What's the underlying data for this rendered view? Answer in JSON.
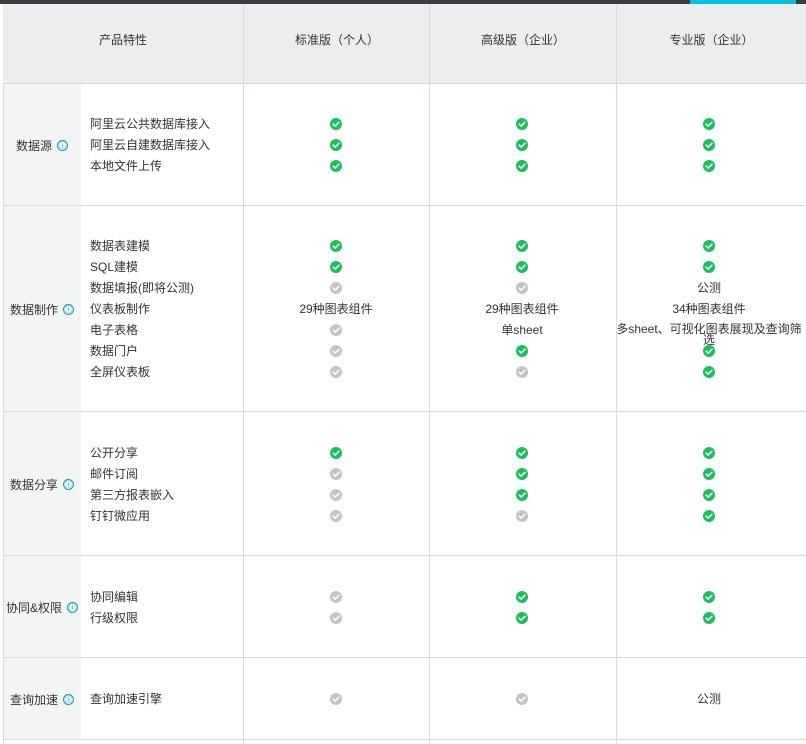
{
  "header": {
    "feature_col": "产品特性",
    "editions": [
      "标准版（个人）",
      "高级版（企业）",
      "专业版（企业）"
    ]
  },
  "info_icon": "ⓘ",
  "colors": {
    "enabled": "#19c15d",
    "disabled": "#c4c4c4",
    "info": "#00a2ca"
  },
  "icons": {
    "enabled": "check-circle-green-icon",
    "disabled": "check-circle-grey-icon"
  },
  "sections": [
    {
      "name": "数据源",
      "features": [
        "阿里云公共数据库接入",
        "阿里云自建数据库接入",
        "本地文件上传"
      ],
      "standard": [
        "yes",
        "yes",
        "yes"
      ],
      "advanced": [
        "yes",
        "yes",
        "yes"
      ],
      "professional": [
        "yes",
        "yes",
        "yes"
      ]
    },
    {
      "name": "数据制作",
      "features": [
        "数据表建模",
        "SQL建模",
        "数据填报(即将公测)",
        "仪表板制作",
        "电子表格",
        "数据门户",
        "全屏仪表板"
      ],
      "standard": [
        "yes",
        "yes",
        "no",
        "29种图表组件",
        "no",
        "no",
        "no"
      ],
      "advanced": [
        "yes",
        "yes",
        "no",
        "29种图表组件",
        "单sheet",
        "yes",
        "no"
      ],
      "professional": [
        "yes",
        "yes",
        "公测",
        "34种图表组件",
        "多sheet、可视化图表展现及查询筛选",
        "yes",
        "yes"
      ]
    },
    {
      "name": "数据分享",
      "features": [
        "公开分享",
        "邮件订阅",
        "第三方报表嵌入",
        "钉钉微应用"
      ],
      "standard": [
        "yes",
        "no",
        "no",
        "no"
      ],
      "advanced": [
        "yes",
        "yes",
        "yes",
        "no"
      ],
      "professional": [
        "yes",
        "yes",
        "yes",
        "yes"
      ]
    },
    {
      "name": "协同&权限",
      "features": [
        "协同编辑",
        "行级权限"
      ],
      "standard": [
        "no",
        "no"
      ],
      "advanced": [
        "yes",
        "yes"
      ],
      "professional": [
        "yes",
        "yes"
      ]
    },
    {
      "name": "查询加速",
      "features": [
        "查询加速引擎"
      ],
      "standard": [
        "no"
      ],
      "advanced": [
        "no"
      ],
      "professional": [
        "公测"
      ]
    }
  ]
}
